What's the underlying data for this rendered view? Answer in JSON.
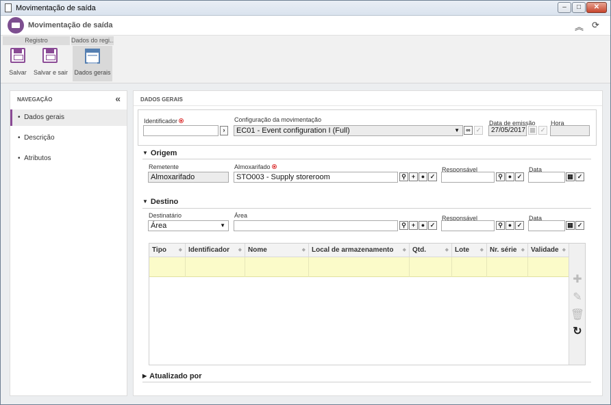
{
  "window": {
    "title": "Movimentação de saída",
    "minimize": "–",
    "maximize": "□",
    "close": "✕"
  },
  "app": {
    "title": "Movimentação de saída"
  },
  "ribbon": {
    "group_registro": "Registro",
    "group_dados": "Dados do regi...",
    "salvar": "Salvar",
    "salvar_sair": "Salvar e sair",
    "dados_gerais": "Dados gerais"
  },
  "nav": {
    "heading": "NAVEGAÇÃO",
    "items": [
      {
        "label": "Dados gerais"
      },
      {
        "label": "Descrição"
      },
      {
        "label": "Atributos"
      }
    ]
  },
  "main": {
    "heading": "DADOS GERAIS",
    "identificador_label": "Identificador",
    "identificador_value": "",
    "config_label": "Configuração da movimentação",
    "config_value": "EC01 - Event configuration I (Full)",
    "data_emissao_label": "Data de emissão",
    "data_emissao_value": "27/05/2017",
    "hora_label": "Hora",
    "hora_value": "",
    "origem": {
      "title": "Origem",
      "remetente_label": "Remetente",
      "remetente_value": "Almoxarifado",
      "almox_label": "Almoxarifado",
      "almox_value": "STO003 - Supply storeroom",
      "responsavel_label": "Responsável",
      "responsavel_value": "",
      "data_label": "Data",
      "data_value": ""
    },
    "destino": {
      "title": "Destino",
      "destinatario_label": "Destinatário",
      "destinatario_value": "Área",
      "area_label": "Área",
      "area_value": "",
      "responsavel_label": "Responsável",
      "responsavel_value": "",
      "data_label": "Data",
      "data_value": ""
    },
    "grid": {
      "columns": [
        "Tipo",
        "Identificador",
        "Nome",
        "Local de armazenamento",
        "Qtd.",
        "Lote",
        "Nr. série",
        "Validade"
      ]
    },
    "atualizado_por": "Atualizado por"
  }
}
